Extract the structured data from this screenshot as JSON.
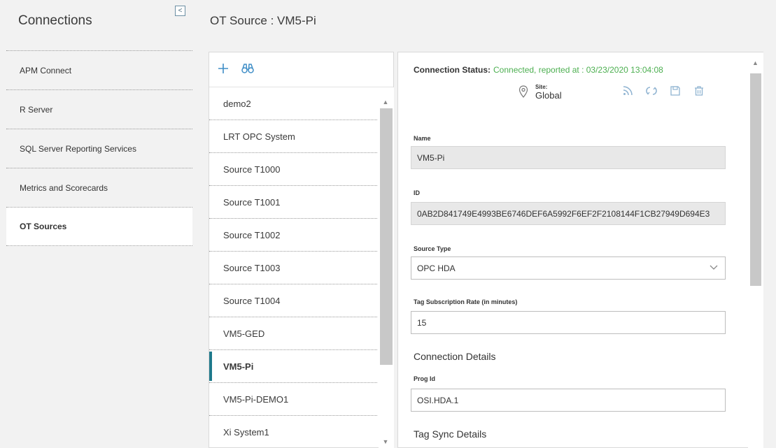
{
  "sidebar": {
    "title": "Connections",
    "collapse_glyph": "<",
    "items": [
      {
        "label": "APM Connect"
      },
      {
        "label": "R Server"
      },
      {
        "label": "SQL Server Reporting Services"
      },
      {
        "label": "Metrics and Scorecards"
      },
      {
        "label": "OT Sources",
        "active": true
      }
    ]
  },
  "page": {
    "title": "OT Source : VM5-Pi"
  },
  "source_list": {
    "toolbar_icons": [
      "plus-icon",
      "binoculars-icon"
    ],
    "items": [
      "demo2",
      "LRT OPC System",
      "Source T1000",
      "Source T1001",
      "Source T1002",
      "Source T1003",
      "Source T1004",
      "VM5-GED",
      "VM5-Pi",
      "VM5-Pi-DEMO1",
      "Xi System1"
    ],
    "selected": "VM5-Pi"
  },
  "details": {
    "status_label": "Connection Status:",
    "status_value": "Connected, reported at : 03/23/2020 13:04:08",
    "site_label": "Site:",
    "site_value": "Global",
    "action_icons": [
      "rss-icon",
      "refresh-icon",
      "save-icon",
      "delete-icon"
    ],
    "name_label": "Name",
    "name_value": "VM5-Pi",
    "id_label": "ID",
    "id_value": "0AB2D841749E4993BE6746DEF6A5992F6EF2F2108144F1CB27949D694E3",
    "source_type_label": "Source Type",
    "source_type_value": "OPC HDA",
    "tag_rate_label": "Tag Subscription Rate (in minutes)",
    "tag_rate_value": "15",
    "connection_details_title": "Connection Details",
    "prog_id_label": "Prog Id",
    "prog_id_value": "OSI.HDA.1",
    "tag_sync_title": "Tag Sync Details"
  },
  "colors": {
    "accent": "#3f8ec7",
    "status_ok": "#4caf50",
    "selected_marker": "#1f7a8c"
  }
}
